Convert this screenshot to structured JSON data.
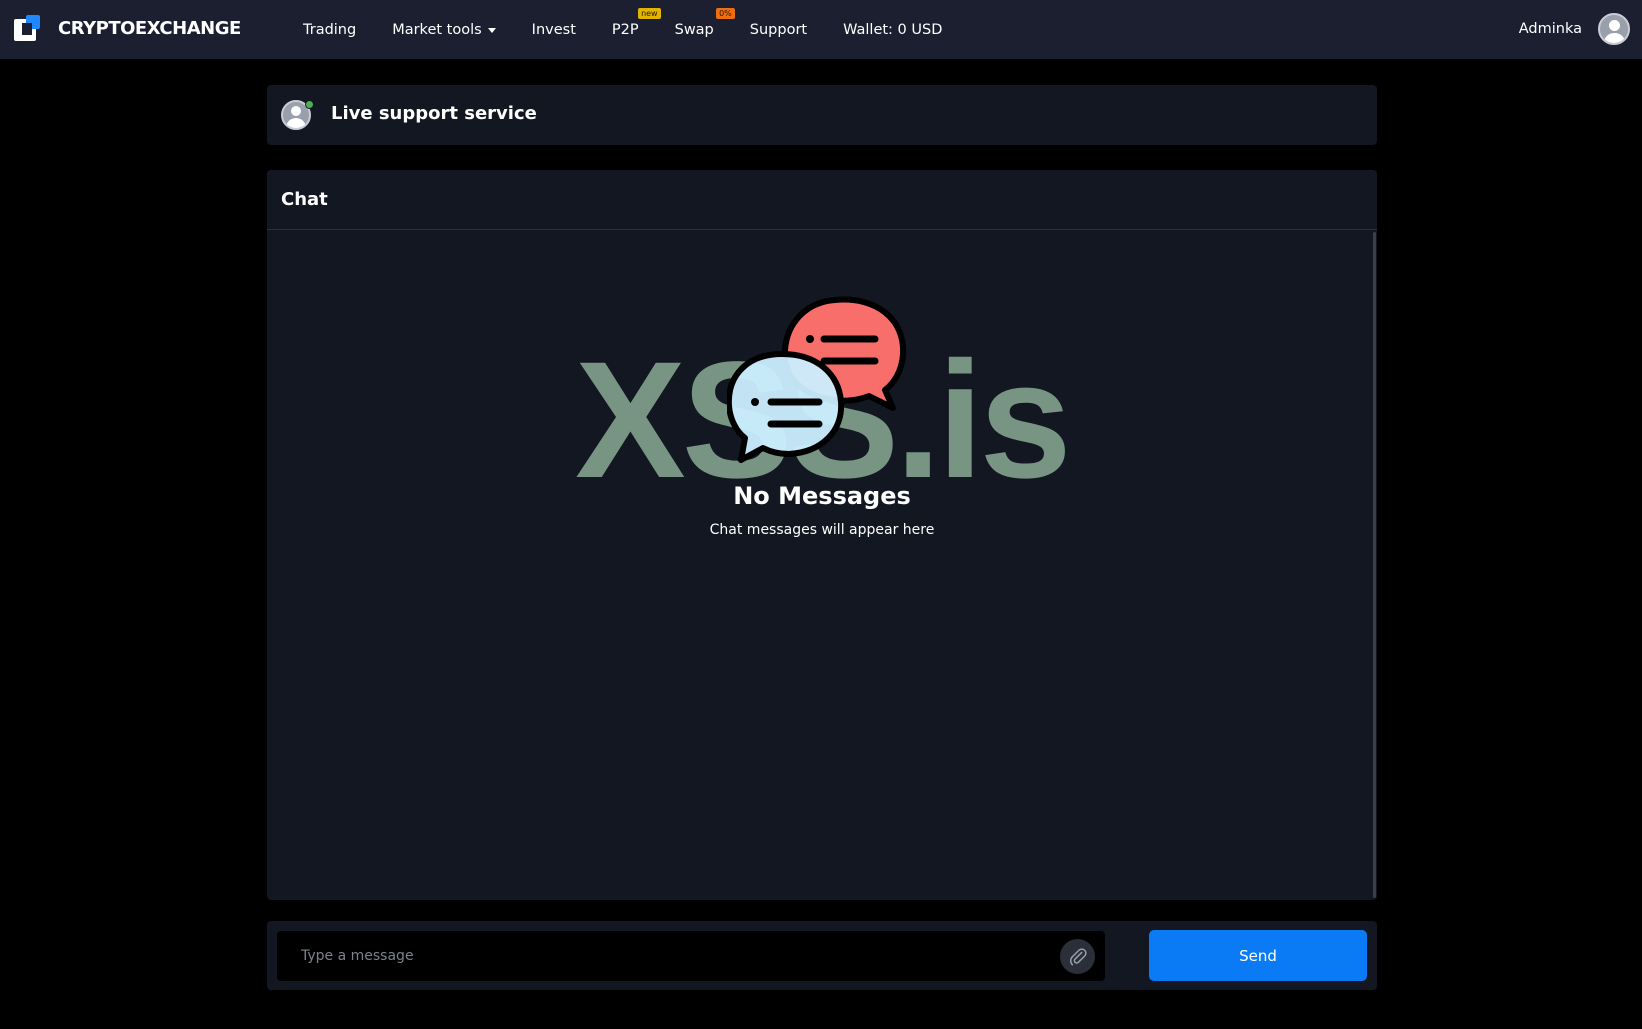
{
  "navbar": {
    "brand": "CRYPTOEXCHANGE",
    "logo_icon": "cryptoexchange-logo-icon",
    "items": [
      {
        "label": "Trading"
      },
      {
        "label": "Market tools",
        "has_dropdown": true
      },
      {
        "label": "Invest"
      },
      {
        "label": "P2P",
        "badge": "new"
      },
      {
        "label": "Swap",
        "badge": "0%"
      },
      {
        "label": "Support"
      },
      {
        "label": "Wallet: 0 USD"
      }
    ],
    "user": {
      "name": "Adminka",
      "avatar_icon": "user-avatar-icon"
    }
  },
  "support": {
    "title": "Live support service",
    "status": "online"
  },
  "chat": {
    "title": "Chat",
    "empty_title": "No Messages",
    "empty_subtitle": "Chat messages will appear here",
    "watermark": "XSS.is",
    "illustration_icon": "chat-bubbles-icon"
  },
  "composer": {
    "placeholder": "Type a message",
    "value": "",
    "attach_icon": "paperclip-icon",
    "send_label": "Send"
  },
  "colors": {
    "navbar_bg": "#1b1f2f",
    "card_bg": "#131722",
    "page_bg": "#000000",
    "accent": "#0b7bf5",
    "badge_new": "#e2b400",
    "badge_zero": "#f06e10",
    "bubble_red": "#f76e6b",
    "bubble_blue": "#cbeeff"
  }
}
